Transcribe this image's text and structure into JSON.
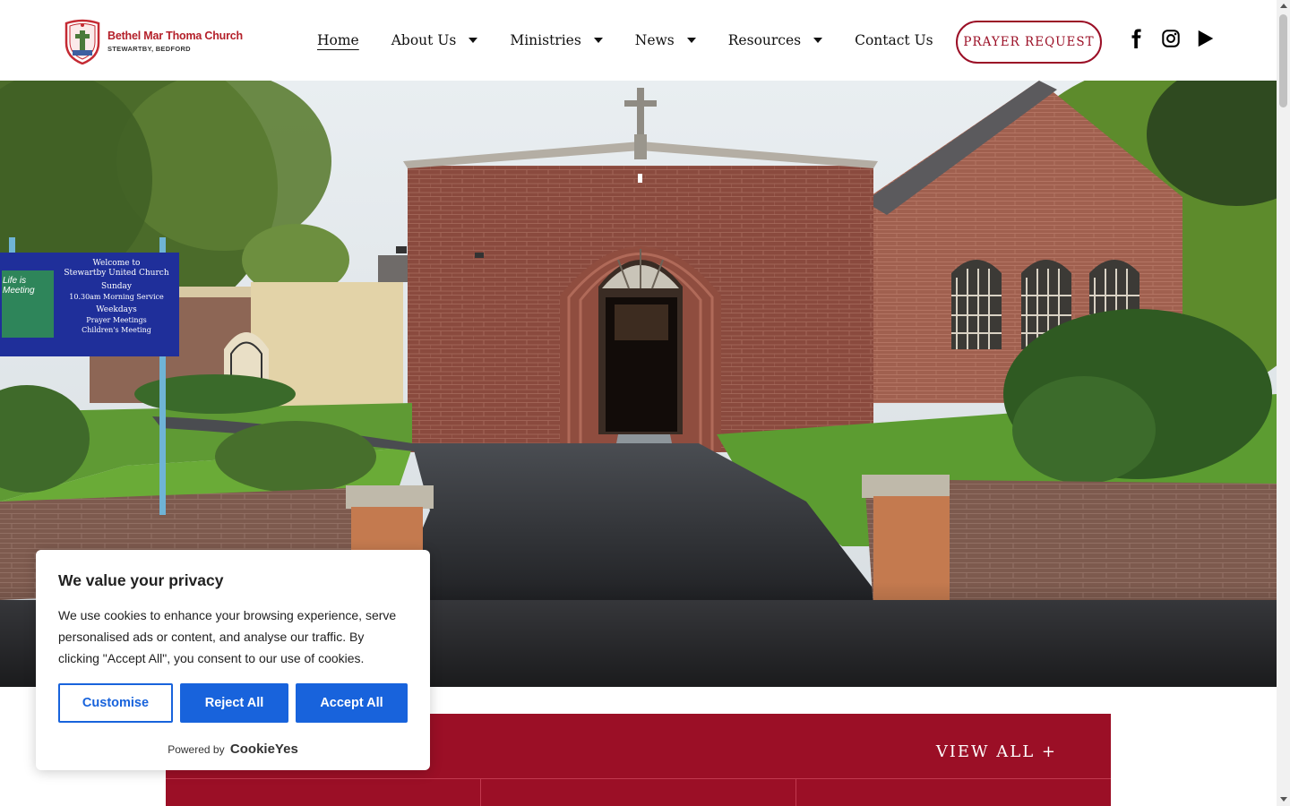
{
  "logo": {
    "title": "Bethel Mar Thoma Church",
    "subtitle": "STEWARTBY, BEDFORD",
    "brand_color": "#b4202a"
  },
  "nav": {
    "items": [
      {
        "label": "Home",
        "active": true,
        "has_dropdown": false
      },
      {
        "label": "About Us",
        "active": false,
        "has_dropdown": true
      },
      {
        "label": "Ministries",
        "active": false,
        "has_dropdown": true
      },
      {
        "label": "News",
        "active": false,
        "has_dropdown": true
      },
      {
        "label": "Resources",
        "active": false,
        "has_dropdown": true
      },
      {
        "label": "Contact Us",
        "active": false,
        "has_dropdown": false
      }
    ]
  },
  "header": {
    "prayer_button": "PRAYER REQUEST",
    "accent_color": "#9b0f26",
    "social_icons": [
      "facebook-icon",
      "instagram-icon",
      "youtube-play-icon"
    ]
  },
  "hero": {
    "sign": {
      "welcome": "Welcome to",
      "church": "Stewartby United Church",
      "sunday": "Sunday",
      "service": "10.30am Morning Service",
      "weekdays": "Weekdays",
      "prayer": "Prayer Meetings",
      "children": "Children's Meeting",
      "poster": "Life is Meeting"
    }
  },
  "band": {
    "view_all": "VIEW ALL  +"
  },
  "cookie": {
    "title": "We value your privacy",
    "body": "We use cookies to enhance your browsing experience, serve personalised ads or content, and analyse our traffic. By clicking \"Accept All\", you consent to our use of cookies.",
    "customise": "Customise",
    "reject": "Reject All",
    "accept": "Accept All",
    "powered_by": "Powered by",
    "brand": "CookieYes",
    "button_color": "#1863dc"
  }
}
